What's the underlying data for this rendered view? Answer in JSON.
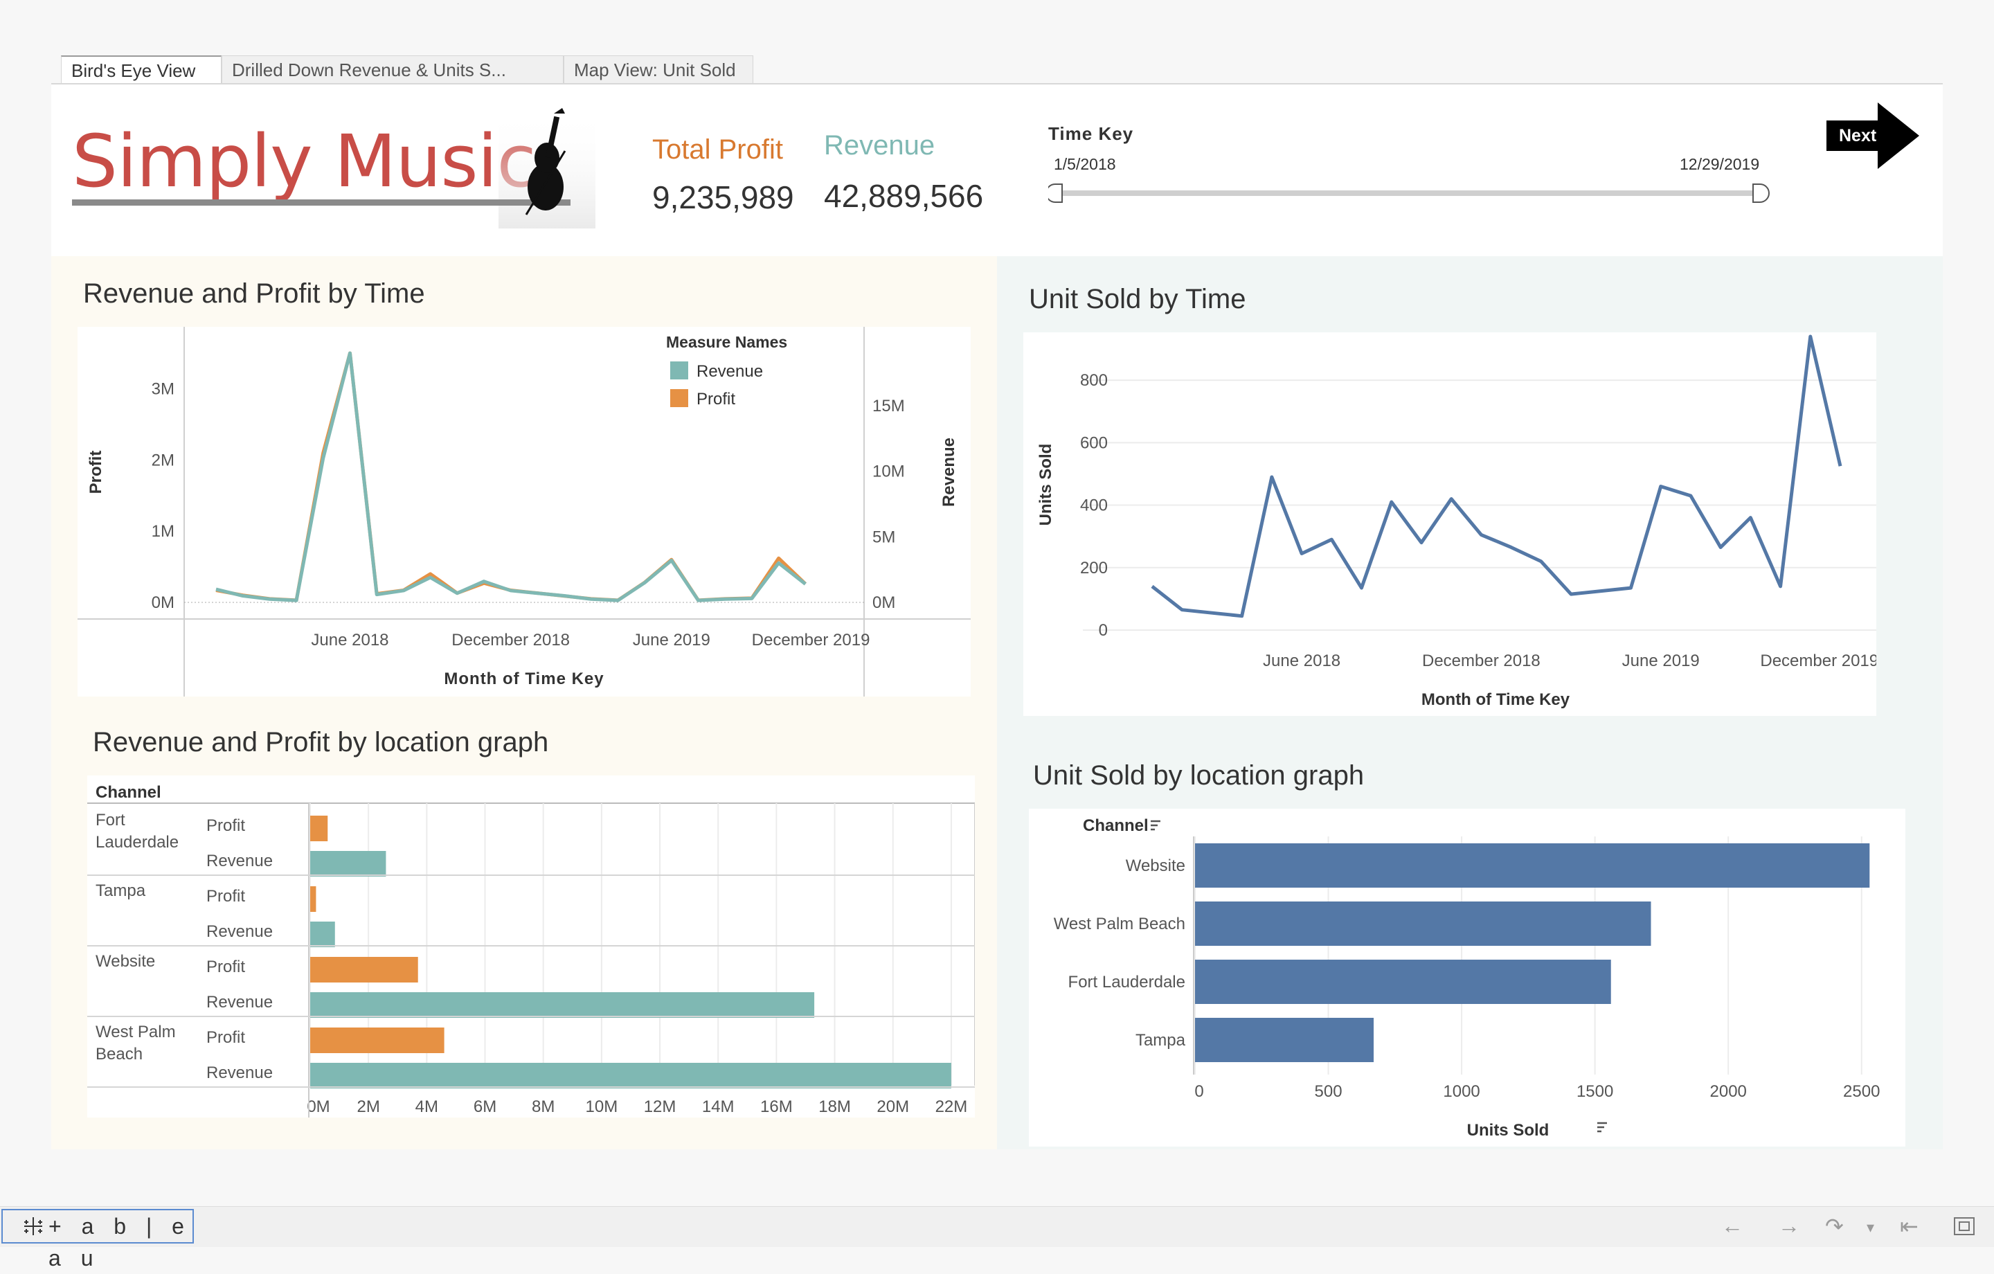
{
  "tabs": [
    {
      "label": "Bird's Eye View"
    },
    {
      "label": "Drilled Down Revenue & Units S..."
    },
    {
      "label": "Map View: Unit Sold"
    }
  ],
  "header": {
    "logo_text": "Simply Music",
    "total_profit_label": "Total Profit",
    "total_profit_value": "9,235,989",
    "revenue_label": "Revenue",
    "revenue_value": "42,889,566",
    "time_key_label": "Time Key",
    "time_key_start": "1/5/2018",
    "time_key_end": "12/29/2019",
    "next_label": "Next"
  },
  "colors": {
    "revenue": "#7fb8b3",
    "profit": "#e69144",
    "units": "#5478a6",
    "logo": "#c84d47",
    "profit_label": "#d8792f",
    "revenue_label": "#7fb8b3"
  },
  "titles": {
    "rev_profit_time": "Revenue and Profit by Time",
    "units_time": "Unit Sold by Time",
    "rev_profit_loc": "Revenue and Profit by location graph",
    "units_loc": "Unit Sold by location graph"
  },
  "chart_data": [
    {
      "type": "line",
      "title": "Revenue and Profit by Time",
      "xlabel": "Month of Time Key",
      "ylabel_left": "Profit",
      "ylabel_right": "Revenue",
      "x_ticks": [
        "June 2018",
        "December 2018",
        "June 2019",
        "December 2019"
      ],
      "y_left_ticks": [
        "0M",
        "1M",
        "2M",
        "3M"
      ],
      "y_right_ticks": [
        "0M",
        "5M",
        "10M",
        "15M"
      ],
      "ylim_left": [
        0,
        3500000
      ],
      "ylim_right": [
        0,
        19000000
      ],
      "legend_title": "Measure Names",
      "legend_position": "top-right",
      "x": [
        "2018-01",
        "2018-02",
        "2018-03",
        "2018-04",
        "2018-05",
        "2018-06",
        "2018-07",
        "2018-08",
        "2018-09",
        "2018-10",
        "2018-11",
        "2018-12",
        "2019-01",
        "2019-02",
        "2019-03",
        "2019-04",
        "2019-05",
        "2019-06",
        "2019-07",
        "2019-08",
        "2019-09",
        "2019-10",
        "2019-11",
        "2019-12"
      ],
      "series": [
        {
          "name": "Revenue",
          "axis": "right",
          "values": [
            1000000,
            500000,
            250000,
            150000,
            11000000,
            19000000,
            600000,
            900000,
            1900000,
            700000,
            1600000,
            900000,
            700000,
            500000,
            250000,
            150000,
            1500000,
            3200000,
            150000,
            250000,
            300000,
            3000000,
            1400000,
            0
          ]
        },
        {
          "name": "Profit",
          "axis": "left",
          "values": [
            170000,
            100000,
            50000,
            30000,
            2100000,
            3500000,
            120000,
            170000,
            400000,
            130000,
            270000,
            170000,
            130000,
            90000,
            50000,
            30000,
            280000,
            600000,
            30000,
            50000,
            60000,
            620000,
            260000,
            0
          ]
        }
      ]
    },
    {
      "type": "line",
      "title": "Unit Sold by Time",
      "xlabel": "Month of Time Key",
      "ylabel": "Units Sold",
      "x_ticks": [
        "June 2018",
        "December 2018",
        "June 2019",
        "December 2019"
      ],
      "y_ticks": [
        "0",
        "200",
        "400",
        "600",
        "800"
      ],
      "ylim": [
        0,
        900
      ],
      "x": [
        "2018-01",
        "2018-02",
        "2018-03",
        "2018-04",
        "2018-05",
        "2018-06",
        "2018-07",
        "2018-08",
        "2018-09",
        "2018-10",
        "2018-11",
        "2018-12",
        "2019-01",
        "2019-02",
        "2019-03",
        "2019-04",
        "2019-05",
        "2019-06",
        "2019-07",
        "2019-08",
        "2019-09",
        "2019-10",
        "2019-11",
        "2019-12"
      ],
      "series": [
        {
          "name": "Units Sold",
          "values": [
            140,
            65,
            55,
            45,
            490,
            245,
            290,
            135,
            410,
            280,
            420,
            305,
            265,
            220,
            115,
            125,
            135,
            460,
            430,
            265,
            360,
            140,
            940,
            525
          ]
        }
      ]
    },
    {
      "type": "bar",
      "orientation": "horizontal",
      "title": "Revenue and Profit by location graph",
      "row_header": "Channel",
      "categories": [
        "Fort Lauderdale",
        "Tampa",
        "Website",
        "West Palm Beach"
      ],
      "measures": [
        "Profit",
        "Revenue"
      ],
      "series": [
        {
          "name": "Profit",
          "values": [
            600000,
            200000,
            3700000,
            4600000
          ]
        },
        {
          "name": "Revenue",
          "values": [
            2600000,
            850000,
            17300000,
            22000000
          ]
        }
      ],
      "x_ticks": [
        "0M",
        "2M",
        "4M",
        "6M",
        "8M",
        "10M",
        "12M",
        "14M",
        "16M",
        "18M",
        "20M",
        "22M"
      ],
      "xlim": [
        0,
        23000000
      ]
    },
    {
      "type": "bar",
      "orientation": "horizontal",
      "title": "Unit Sold by location graph",
      "row_header": "Channel",
      "xlabel": "Units Sold",
      "categories": [
        "Website",
        "West Palm Beach",
        "Fort Lauderdale",
        "Tampa"
      ],
      "values": [
        2530,
        1710,
        1560,
        670
      ],
      "x_ticks": [
        "0",
        "500",
        "1000",
        "1500",
        "2000",
        "2500"
      ],
      "xlim": [
        0,
        2550
      ]
    }
  ],
  "footer": {
    "logo_text": "+ a b | e a u"
  }
}
